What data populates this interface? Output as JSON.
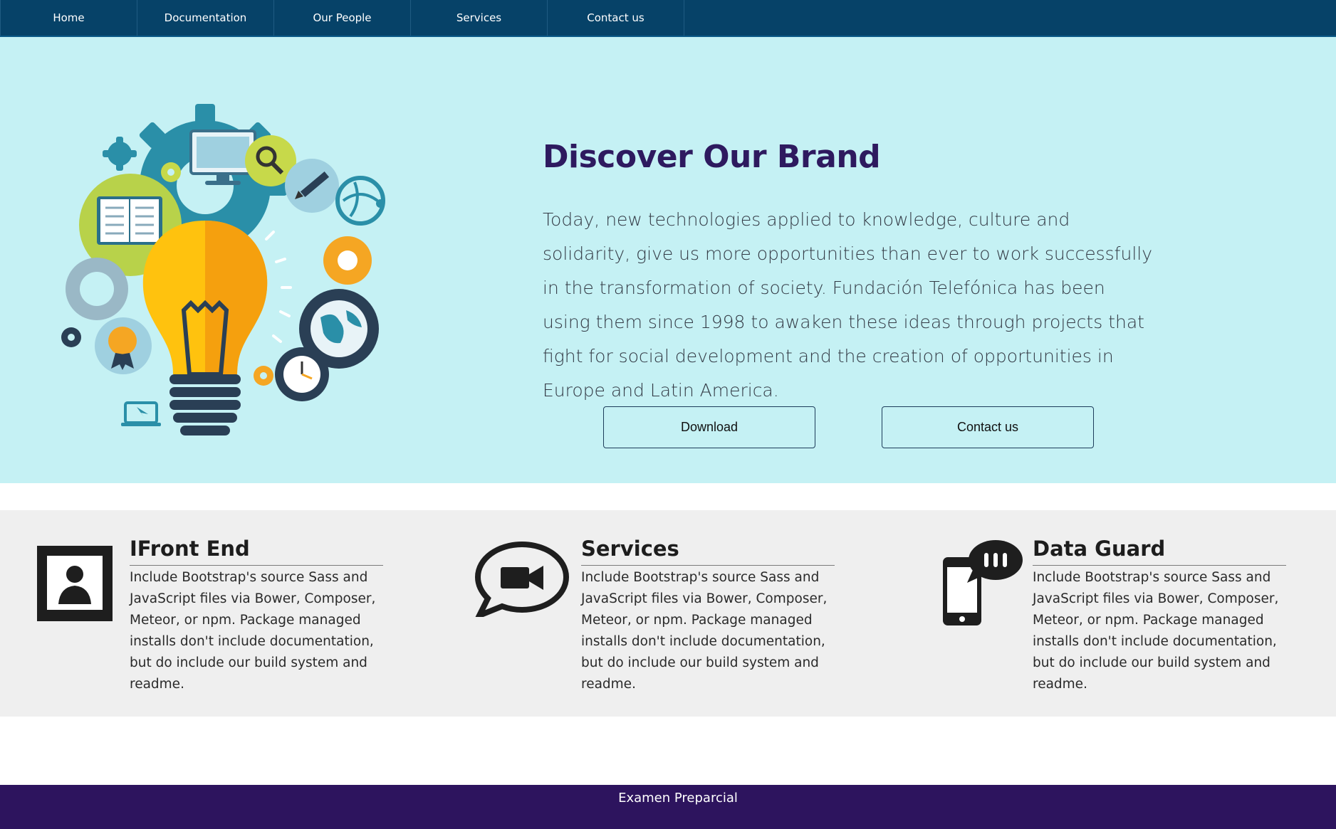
{
  "nav": {
    "items": [
      {
        "label": "Home"
      },
      {
        "label": "Documentation"
      },
      {
        "label": "Our People"
      },
      {
        "label": "Services"
      },
      {
        "label": "Contact us"
      }
    ]
  },
  "hero": {
    "illustration": "lightbulb-gears-technology-illustration",
    "title": "Discover Our Brand",
    "text": "Today, new technologies applied to knowledge, culture and solidarity, give us more opportunities than ever to work successfully in the transformation of society. Fundación Telefónica has been using them since 1998 to awaken these ideas through projects that fight for social development and the creation of opportunities in Europe and Latin America.",
    "buttons": {
      "download": "Download",
      "contact": "Contact us"
    },
    "background_color": "#c5f1f4",
    "title_color": "#2e1a5f"
  },
  "features": [
    {
      "icon": "portrait-frame-icon",
      "title": "IFront End",
      "text": "Include Bootstrap's source Sass and JavaScript files via Bower, Composer, Meteor, or npm. Package managed installs don't include documentation, but do include our build system and readme."
    },
    {
      "icon": "video-chat-bubble-icon",
      "title": "Services",
      "text": "Include Bootstrap's source Sass and JavaScript files via Bower, Composer, Meteor, or npm. Package managed installs don't include documentation, but do include our build system and readme."
    },
    {
      "icon": "phone-message-icon",
      "title": "Data Guard",
      "text": "Include Bootstrap's source Sass and JavaScript files via Bower, Composer, Meteor, or npm. Package managed installs don't include documentation, but do include our build system and readme."
    }
  ],
  "footer": {
    "text": "Examen Preparcial",
    "background_color": "#2d145e"
  },
  "colors": {
    "nav": "#064268",
    "features_bg": "#efefef"
  }
}
